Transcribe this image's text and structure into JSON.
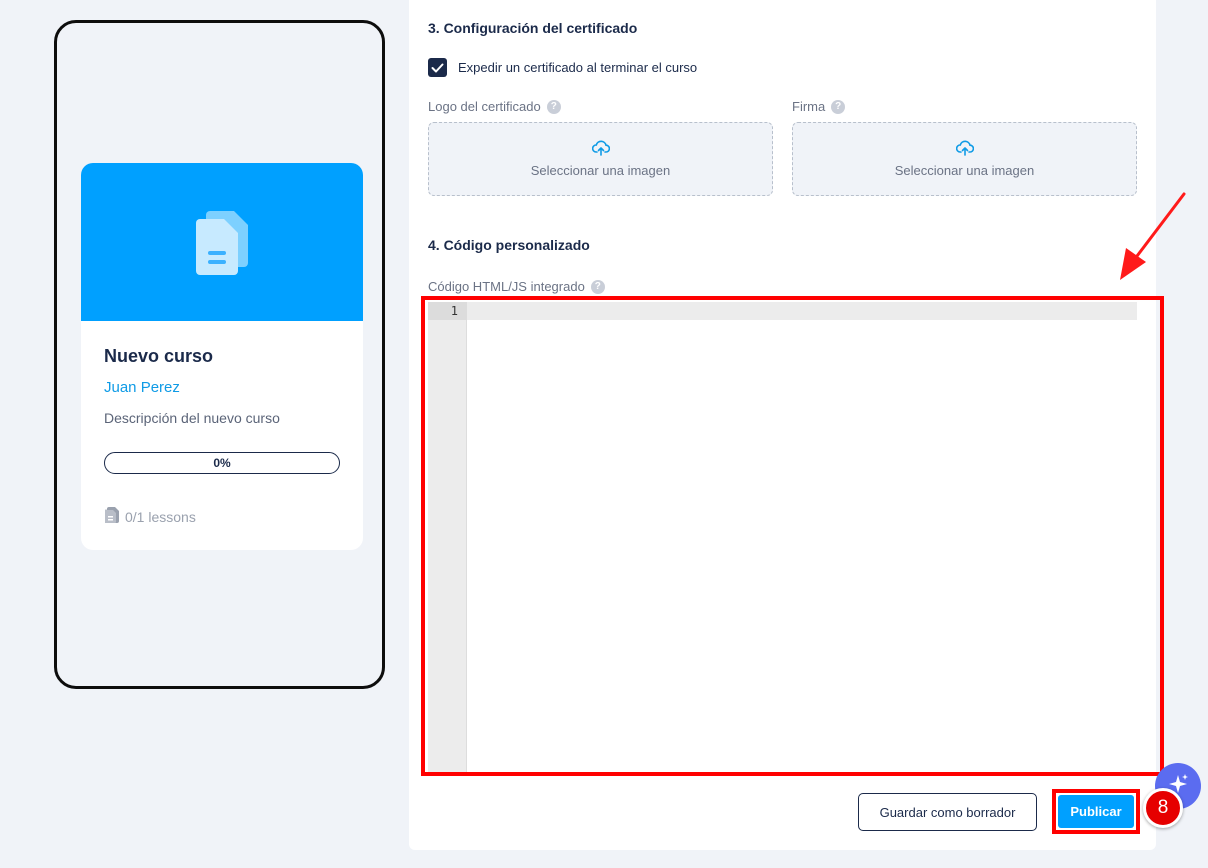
{
  "preview": {
    "course_title": "Nuevo curso",
    "author": "Juan Perez",
    "description": "Descripción del nuevo curso",
    "progress_value": 0,
    "progress_label": "0%",
    "lessons_label": "0/1 lessons"
  },
  "certificate": {
    "section_title": "3. Configuración del certificado",
    "issue_checkbox_label": "Expedir un certificado al terminar el curso",
    "issue_checked": true,
    "logo_label": "Logo del certificado",
    "signature_label": "Firma",
    "upload_text": "Seleccionar una imagen"
  },
  "custom_code": {
    "section_title": "4. Código personalizado",
    "field_label": "Código HTML/JS integrado",
    "line_number": "1"
  },
  "actions": {
    "draft_label": "Guardar como borrador",
    "publish_label": "Publicar"
  },
  "annotation": {
    "step_number": "8"
  },
  "colors": {
    "accent": "#00a0ff",
    "navy": "#1b2a4a",
    "highlight": "#ff0000"
  }
}
